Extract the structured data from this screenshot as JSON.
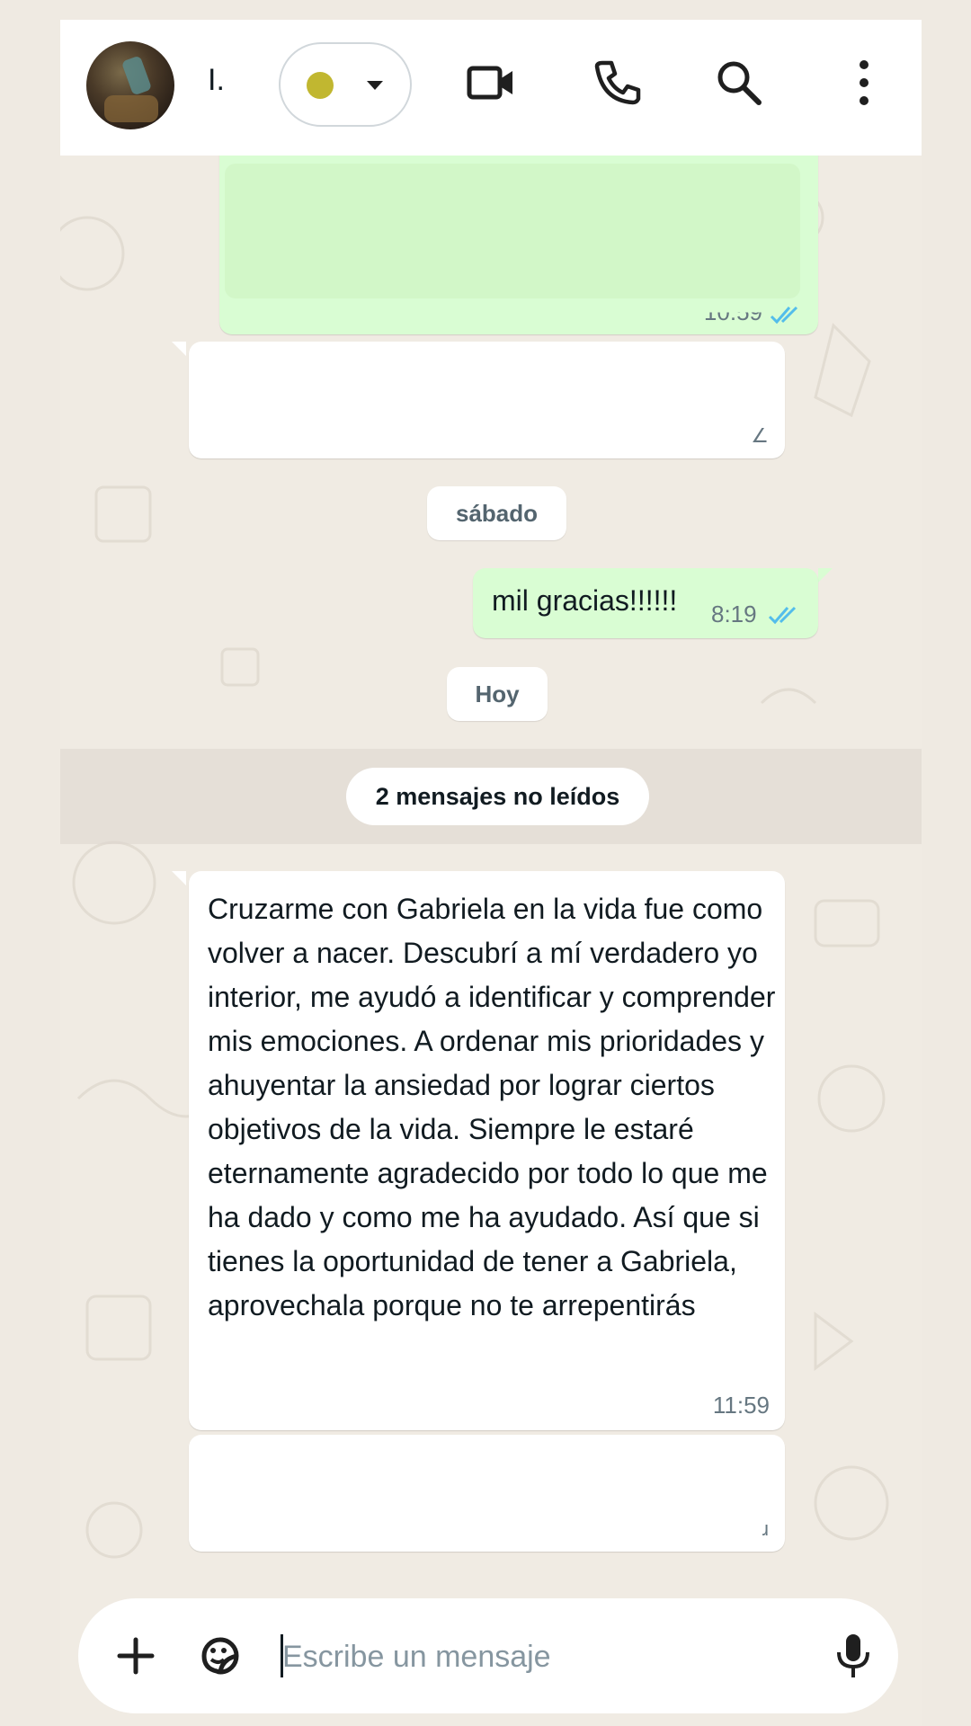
{
  "header": {
    "contact_name": "I.",
    "status_dot_color": "#c1b730",
    "icons": [
      "video-call-icon",
      "voice-call-icon",
      "search-icon",
      "more-options-icon"
    ]
  },
  "chat": {
    "outgoing_time_partial": "10:59",
    "date_saturday": "sábado",
    "message_thanks": "mil gracias!!!!!!",
    "message_thanks_time": "8:19",
    "date_today": "Hoy",
    "unread_banner": "2 mensajes no leídos",
    "testimonial_text": "Cruzarme con Gabriela en la vida fue como volver a nacer. Descubrí a mí verdadero yo interior, me ayudó a identificar y comprender mis emociones. A ordenar mis prioridades y ahuyentar la ansiedad por lograr ciertos objetivos de la vida. Siempre le estaré eternamente agradecido por todo lo que me ha dado y como me ha ayudado. Así que si tienes la oportunidad de tener a Gabriela, aprovechala porque no te arrepentirás",
    "testimonial_time": "11:59"
  },
  "composer": {
    "placeholder": "Escribe un mensaje",
    "icons": [
      "attach-plus-icon",
      "sticker-icon",
      "microphone-icon"
    ]
  },
  "colors": {
    "outgoing_bubble": "#d9fdd3",
    "incoming_bubble": "#ffffff",
    "chat_background": "#f0ebe3",
    "read_ticks": "#53bdeb"
  }
}
